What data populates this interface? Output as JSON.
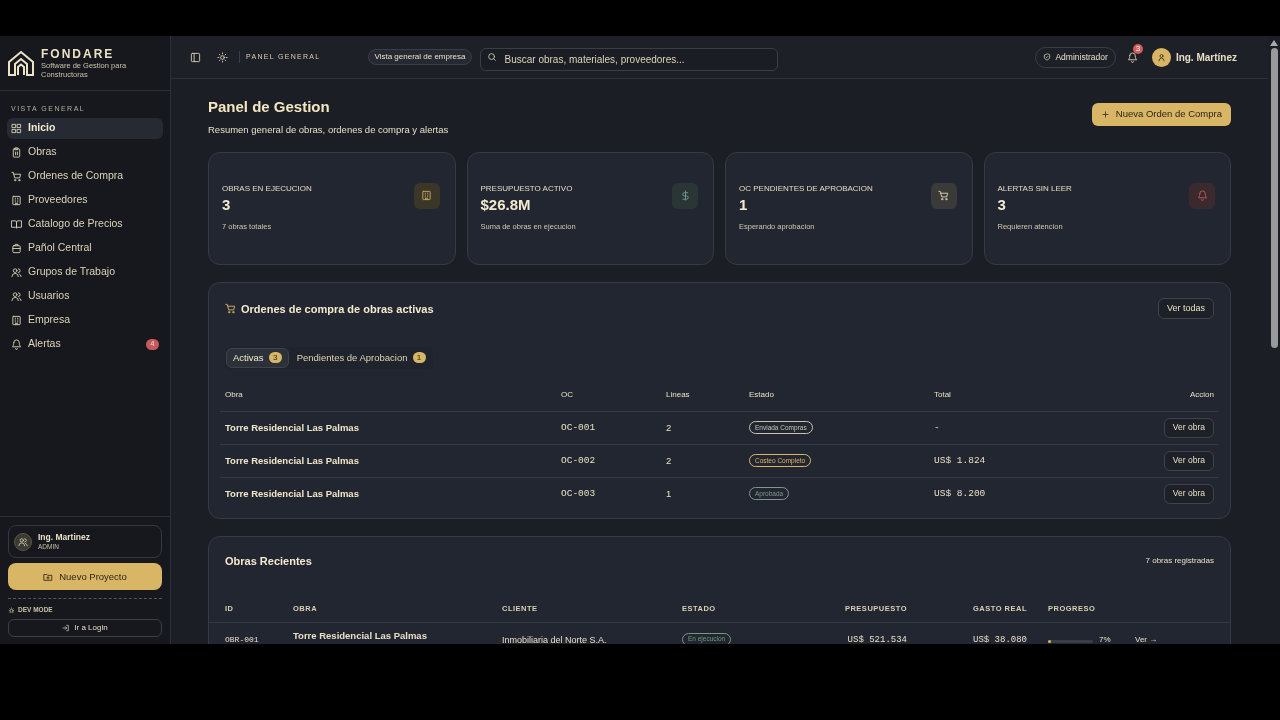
{
  "brand": {
    "name": "FONDARE",
    "tagline": "Software de Gestion para Constructoras"
  },
  "sidebar": {
    "section": "VISTA GENERAL",
    "items": [
      {
        "label": "Inicio",
        "selected": true
      },
      {
        "label": "Obras",
        "selected": false
      },
      {
        "label": "Ordenes de Compra",
        "selected": false
      },
      {
        "label": "Proveedores",
        "selected": false
      },
      {
        "label": "Catalogo de Precios",
        "selected": false
      },
      {
        "label": "Pañol Central",
        "selected": false
      },
      {
        "label": "Grupos de Trabajo",
        "selected": false
      },
      {
        "label": "Usuarios",
        "selected": false
      },
      {
        "label": "Empresa",
        "selected": false
      },
      {
        "label": "Alertas",
        "selected": false,
        "badge": "4"
      }
    ],
    "user": {
      "name": "Ing. Martinez",
      "role": "ADMIN"
    },
    "new_project": "Nuevo Proyecto",
    "dev_mode": "DEV MODE",
    "login": "Ir a Login"
  },
  "topbar": {
    "breadcrumb": "PANEL GENERAL",
    "scope": "Vista general de empresa",
    "search": {
      "placeholder": "Buscar obras, materiales, proveedores..."
    },
    "role": "Administrador",
    "notifications": "3",
    "user": "Ing. Martínez"
  },
  "header": {
    "title": "Panel de Gestion",
    "subtitle": "Resumen general de obras, ordenes de compra y alertas",
    "action": "Nueva Orden de Compra"
  },
  "stats": [
    {
      "label": "OBRAS EN EJECUCION",
      "value": "3",
      "note": "7 obras totales"
    },
    {
      "label": "PRESUPUESTO ACTIVO",
      "value": "$26.8M",
      "note": "Suma de obras en ejecucion"
    },
    {
      "label": "OC PENDIENTES DE APROBACION",
      "value": "1",
      "note": "Esperando aprobacion"
    },
    {
      "label": "ALERTAS SIN LEER",
      "value": "3",
      "note": "Requieren atencion"
    }
  ],
  "orders": {
    "title": "Ordenes de compra de obras activas",
    "view_all": "Ver todas",
    "tabs": [
      {
        "label": "Activas",
        "count": "3",
        "selected": true
      },
      {
        "label": "Pendientes de Aprobacion",
        "count": "1",
        "selected": false
      }
    ],
    "columns": [
      "Obra",
      "OC",
      "Lineas",
      "Estado",
      "Total",
      "Accion"
    ],
    "rows": [
      {
        "obra": "Torre Residencial Las Palmas",
        "oc": "OC-001",
        "lineas": "2",
        "estado": "Enviada Compras",
        "color": "#c9c2b0",
        "total": "-",
        "action": "Ver obra"
      },
      {
        "obra": "Torre Residencial Las Palmas",
        "oc": "OC-002",
        "lineas": "2",
        "estado": "Costeo Completo",
        "color": "#d9b566",
        "total": "US$ 1.824",
        "action": "Ver obra"
      },
      {
        "obra": "Torre Residencial Las Palmas",
        "oc": "OC-003",
        "lineas": "1",
        "estado": "Aprobada",
        "color": "#7f968c",
        "total": "US$ 8.200",
        "action": "Ver obra"
      }
    ]
  },
  "recent": {
    "title": "Obras Recientes",
    "count": "7 obras registradas",
    "columns": [
      "ID",
      "OBRA",
      "CLIENTE",
      "ESTADO",
      "PRESUPUESTO",
      "GASTO REAL",
      "PROGRESO"
    ],
    "rows": [
      {
        "id": "OBR-001",
        "obra": "Torre Residencial Las Palmas",
        "cliente": "Inmobiliaria del Norte S.A.",
        "estado": "En ejecucion",
        "color": "#6f9a7c",
        "presupuesto": "US$ 521.534",
        "gasto": "US$ 38.080",
        "level": 0.07,
        "progress": "7%",
        "action": "Ver →"
      }
    ]
  }
}
